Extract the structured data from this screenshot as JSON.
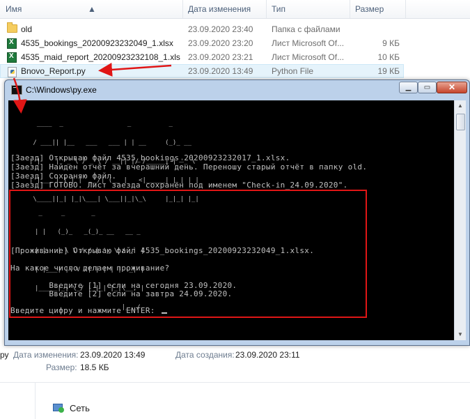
{
  "explorer": {
    "columns": {
      "name": "Имя",
      "date": "Дата изменения",
      "type": "Тип",
      "size": "Размер"
    },
    "files": [
      {
        "name": "old",
        "date": "23.09.2020 23:40",
        "type": "Папка с файлами",
        "size": "",
        "icon": "folder-icon"
      },
      {
        "name": "4535_bookings_20200923232049_1.xlsx",
        "date": "23.09.2020 23:20",
        "type": "Лист Microsoft Of...",
        "size": "9 КБ",
        "icon": "excel-icon"
      },
      {
        "name": "4535_maid_report_20200923232108_1.xls",
        "date": "23.09.2020 23:21",
        "type": "Лист Microsoft Of...",
        "size": "10 КБ",
        "icon": "excel-icon"
      },
      {
        "name": "Bnovo_Report.py",
        "date": "23.09.2020 13:49",
        "type": "Python File",
        "size": "19 КБ",
        "icon": "python-file-icon"
      }
    ]
  },
  "details": {
    "type_fragment": "ру",
    "modified_label": "Дата изменения:",
    "modified_value": "23.09.2020 13:49",
    "created_label": "Дата создания:",
    "created_value": "23.09.2020 23:11",
    "size_label": "Размер:",
    "size_value": "18.5 КБ"
  },
  "nav": {
    "network_label": "Сеть"
  },
  "console": {
    "title": "C:\\Windows\\py.exe",
    "banner_checkin": [
      "  ____  _                 _          _       ",
      " / ___|| |__   ___   ___ | | __     (_)_ __  ",
      "| |    | '_ \\ / _ \\ / __|| |/ /_____| | '_ \\ ",
      "| |___ | | | |  __/| (__ |   <|_____| | | | |",
      " \\____||_| |_|\\___| \\___||_|\\_\\     |_|_| |_|"
    ],
    "lines_checkin": [
      "[Заезд] Открываю файл 4535_bookings_20200923232017_1.xlsx.",
      "[Заезд] Найден отчёт за вчерашний день. Переношу старый отчёт в папку old.",
      "[Заезд] Сохраняю файл.",
      "[Заезд] ГОТОВО. Лист заезда сохранён под именем \"Check-in_24.09.2020\"."
    ],
    "banner_living": [
      " _     _       _             ",
      "| |   (_)_   _(_)_ __   __ _ ",
      "| |   | \\ \\ / / | '_ \\ / _` |",
      "| |___| |\\ V /| | | | | (_| |",
      "|_____|_| \\_/ |_|_| |_|\\__, |",
      "                       |___/ "
    ],
    "line_living_open": "[Проживание] Открываю файл 4535_bookings_20200923232049_1.xlsx.",
    "question": "На какое число делаем проживание?",
    "option1": "        Введите [1] если на сегодня 23.09.2020.",
    "option2": "        Введите [2] если на завтра 24.09.2020.",
    "prompt": "Введите цифру и нажмите ENTER: "
  },
  "colors": {
    "console_bg": "#000000",
    "console_text": "#c0c0c0",
    "annotation": "#e01616",
    "selected_row": "#e5f3fb"
  }
}
